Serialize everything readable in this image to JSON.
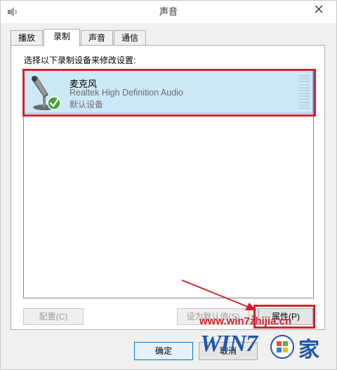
{
  "window": {
    "title": "声音"
  },
  "tabs": [
    {
      "label": "播放"
    },
    {
      "label": "录制"
    },
    {
      "label": "声音"
    },
    {
      "label": "通信"
    }
  ],
  "recording": {
    "instruction": "选择以下录制设备来修改设置:",
    "devices": [
      {
        "name": "麦克风",
        "description": "Realtek High Definition Audio",
        "status": "默认设备"
      }
    ]
  },
  "buttons": {
    "configure": "配置(C)",
    "set_default": "设为默认值(S)",
    "properties": "属性(P)",
    "ok": "确定",
    "cancel": "取消"
  },
  "watermark": {
    "url": "www.win7zhijia.cn",
    "logo_text": "WIN7",
    "logo_suffix": "家"
  },
  "colors": {
    "highlight_red": "#d0242d",
    "selection_blue": "#cde8f7",
    "watermark_blue": "#1f56a8"
  },
  "icons": {
    "app": "speaker-icon",
    "close": "close-icon",
    "device": "microphone-icon",
    "default_badge": "check-badge-icon"
  }
}
